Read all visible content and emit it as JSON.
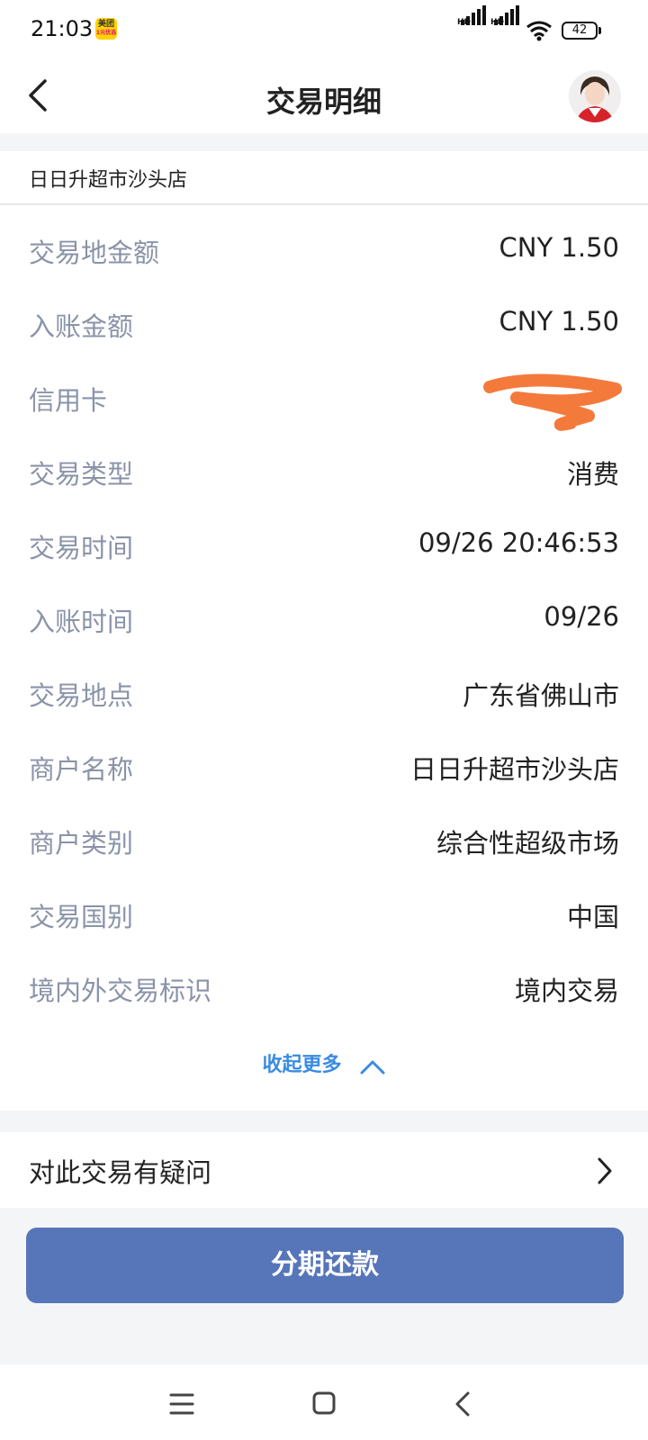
{
  "status_bar": {
    "time": "21:03",
    "app_badge_top": "美团",
    "app_badge_bottom": "1元优选",
    "signal1_label": "HD",
    "signal2_label": "HD",
    "battery": "42"
  },
  "header": {
    "title": "交易明细",
    "back_icon": "chevron-left-icon",
    "avatar_icon": "service-agent-avatar"
  },
  "merchant_name": "日日升超市沙头店",
  "details": [
    {
      "label": "交易地金额",
      "value": "CNY 1.50"
    },
    {
      "label": "入账金额",
      "value": "CNY 1.50"
    },
    {
      "label": "信用卡",
      "value": ""
    },
    {
      "label": "交易类型",
      "value": "消费"
    },
    {
      "label": "交易时间",
      "value": "09/26 20:46:53"
    },
    {
      "label": "入账时间",
      "value": "09/26"
    },
    {
      "label": "交易地点",
      "value": "广东省佛山市"
    },
    {
      "label": "商户名称",
      "value": "日日升超市沙头店"
    },
    {
      "label": "商户类别",
      "value": "综合性超级市场"
    },
    {
      "label": "交易国别",
      "value": "中国"
    },
    {
      "label": "境内外交易标识",
      "value": "境内交易"
    }
  ],
  "collapse_label": "收起更多",
  "question_label": "对此交易有疑问",
  "installment_button": "分期还款",
  "colors": {
    "accent_blue": "#3a8be0",
    "button_blue": "#5776b9",
    "label_gray": "#8a93a8",
    "redaction_orange": "#f47a3c"
  }
}
